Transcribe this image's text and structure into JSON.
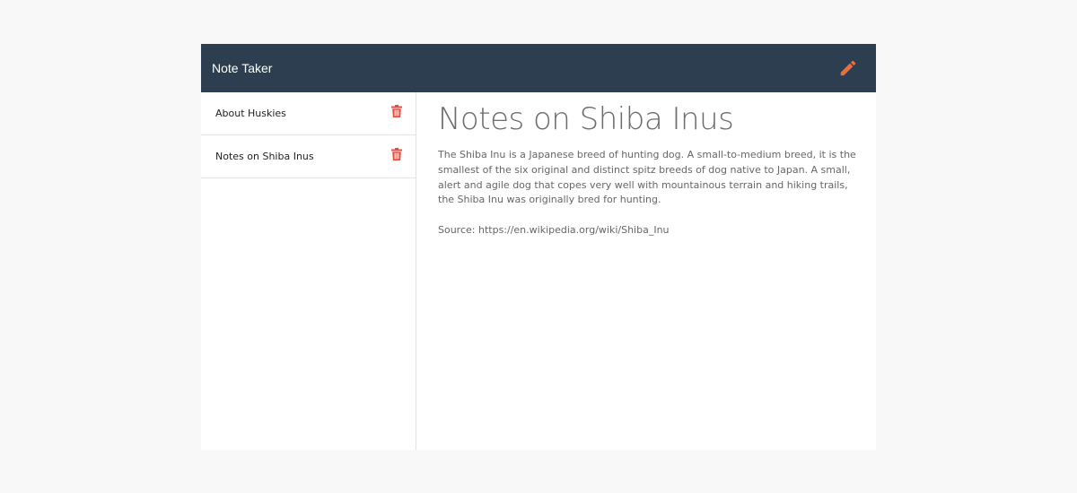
{
  "navbar": {
    "brand": "Note Taker",
    "edit_icon": "pencil-icon",
    "edit_color": "#f26b3a"
  },
  "notes": [
    {
      "title": "About Huskies",
      "delete_icon": "trash-icon"
    },
    {
      "title": "Notes on Shiba Inus",
      "delete_icon": "trash-icon"
    }
  ],
  "active_note": {
    "title": "Notes on Shiba Inus",
    "text": "The Shiba Inu is a Japanese breed of hunting dog. A small-to-medium breed, it is the smallest of the six original and distinct spitz breeds of dog native to Japan. A small, alert and agile dog that copes very well with mountainous terrain and hiking trails, the Shiba Inu was originally bred for hunting.\n\nSource: https://en.wikipedia.org/wiki/Shiba_Inu"
  },
  "colors": {
    "navbar_bg": "#2c3e4f",
    "delete_red": "#e74c3c",
    "background": "#f8f8f8"
  }
}
